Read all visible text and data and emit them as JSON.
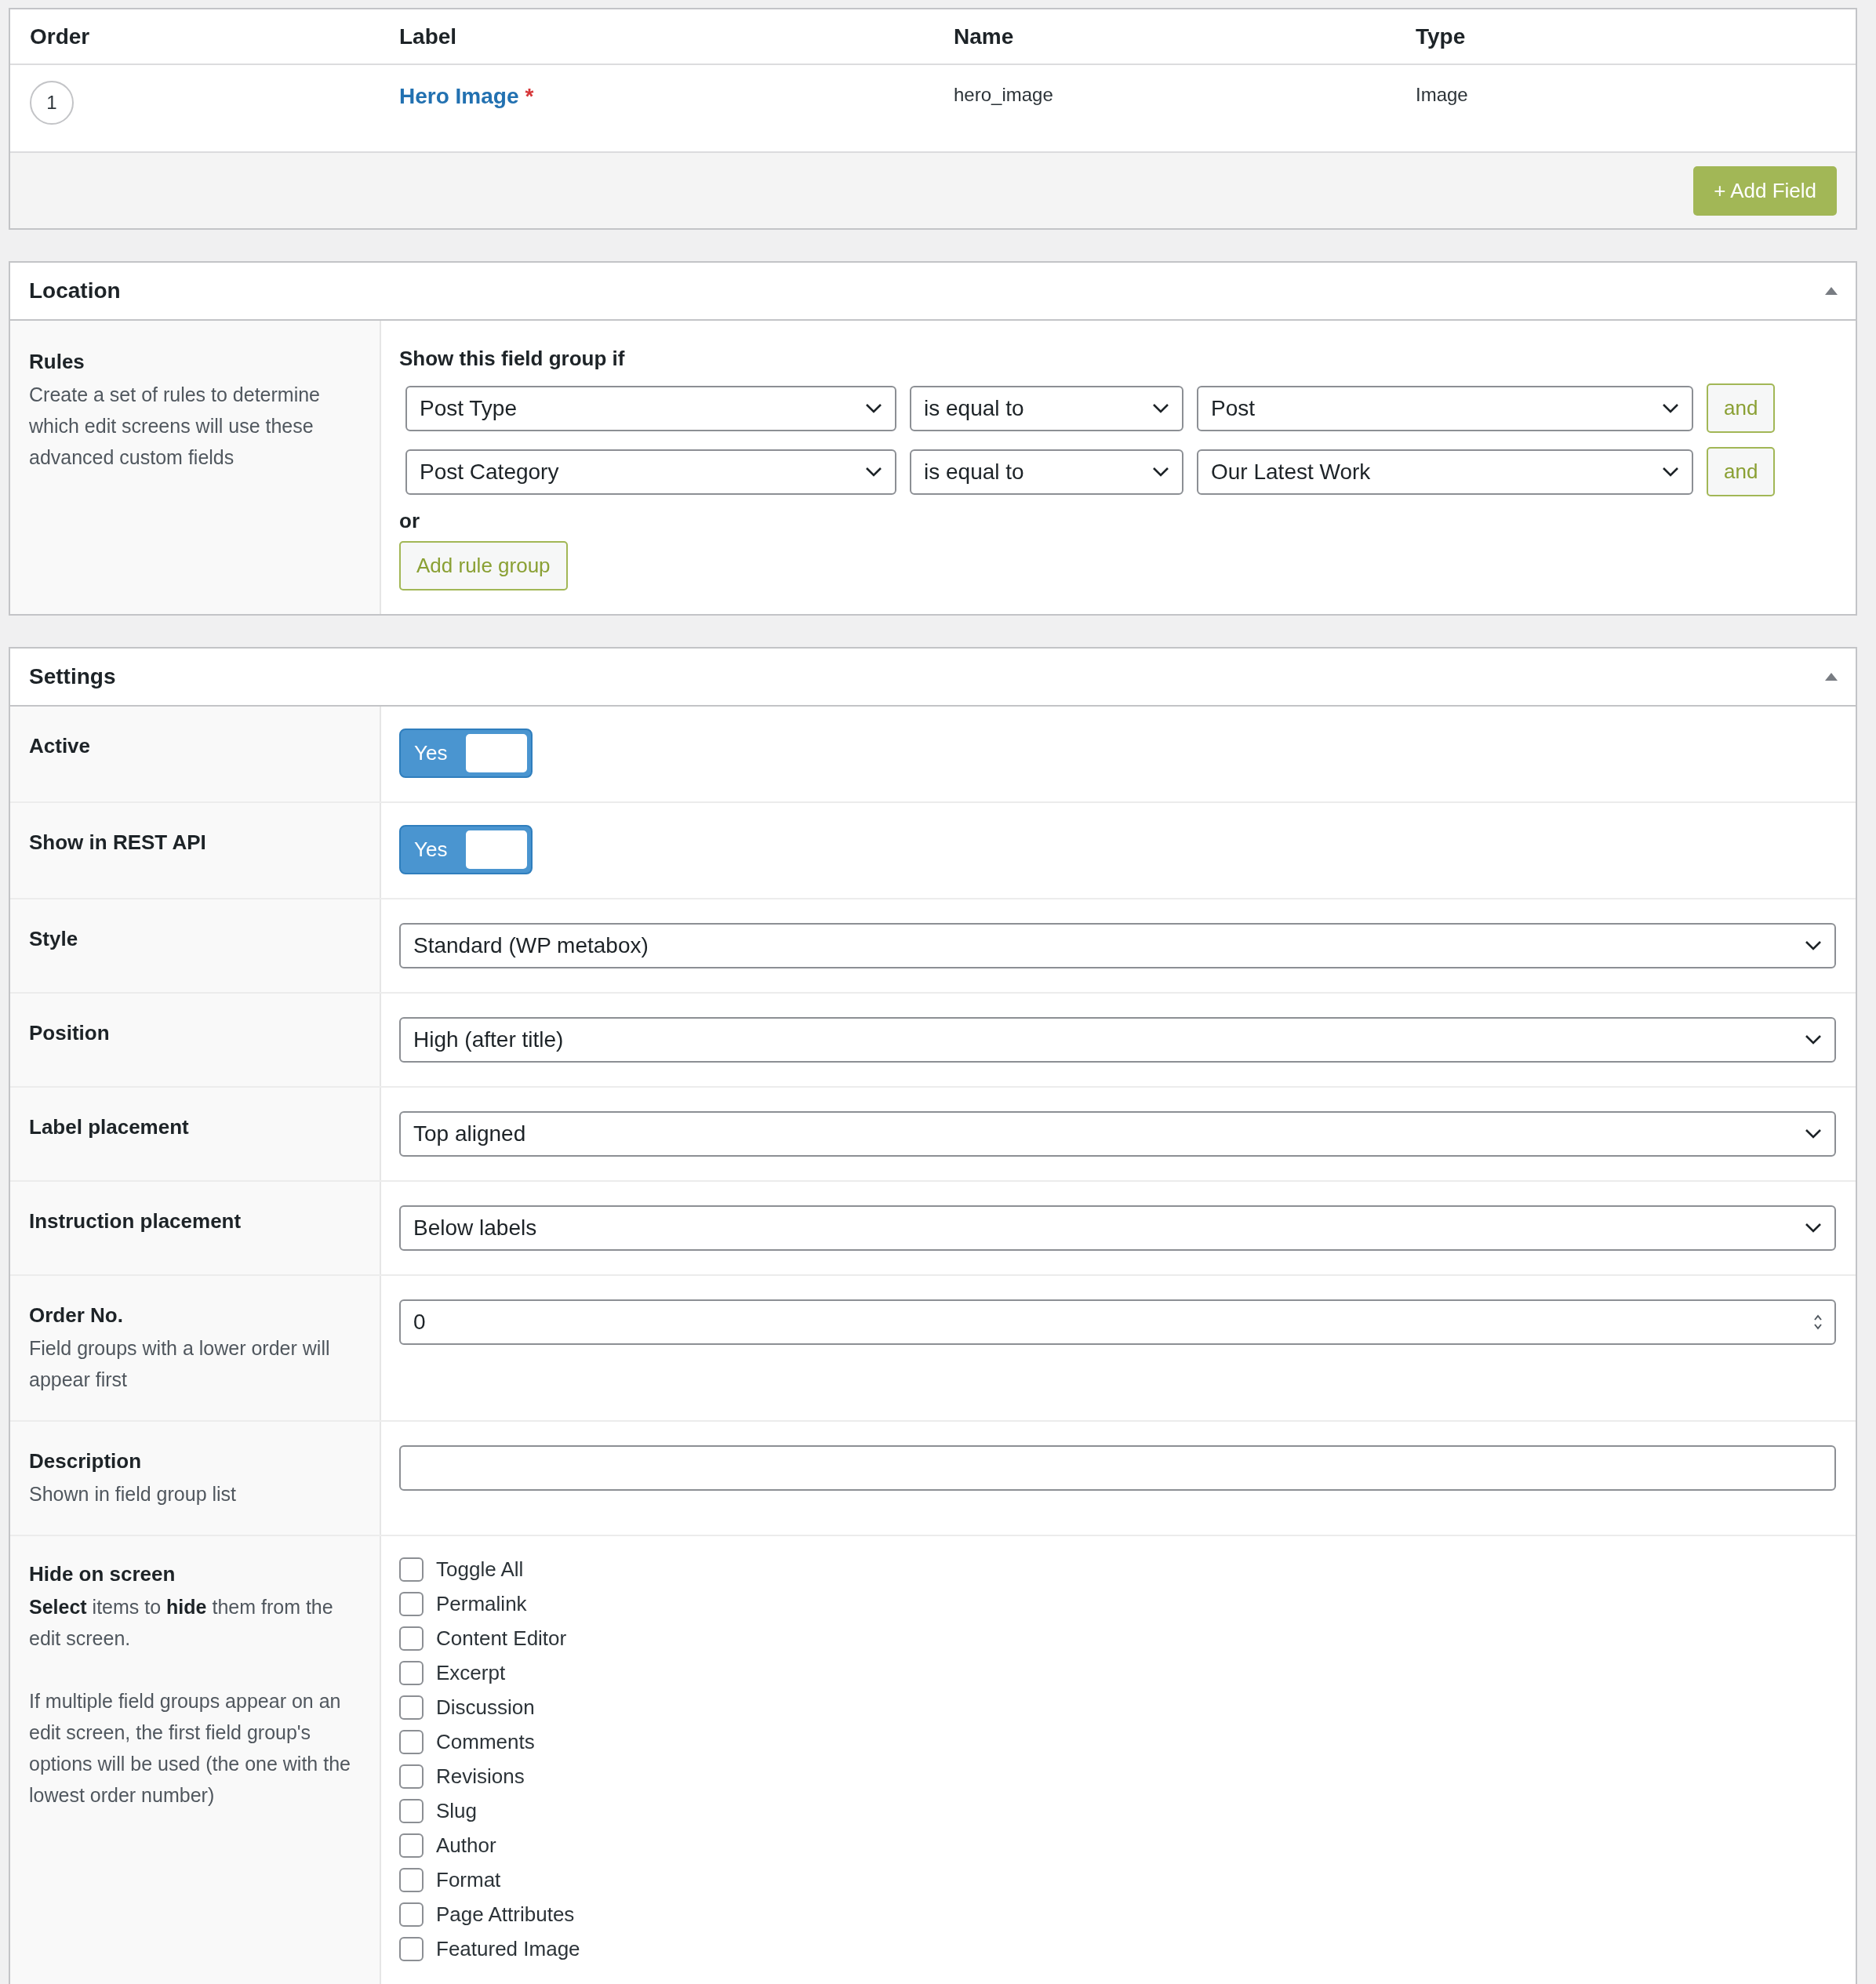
{
  "fields_table": {
    "columns": [
      "Order",
      "Label",
      "Name",
      "Type"
    ],
    "rows": [
      {
        "order": "1",
        "label": "Hero Image",
        "required_mark": "*",
        "name": "hero_image",
        "type": "Image"
      }
    ],
    "add_button": "+ Add Field"
  },
  "location": {
    "title": "Location",
    "expanded": true,
    "rules_label": "Rules",
    "rules_description": "Create a set of rules to determine which edit screens will use these advanced custom fields",
    "group_heading": "Show this field group if",
    "rules": [
      {
        "param": "Post Type",
        "operator": "is equal to",
        "value": "Post",
        "and_button": "and"
      },
      {
        "param": "Post Category",
        "operator": "is equal to",
        "value": "Our Latest Work",
        "and_button": "and"
      }
    ],
    "or_label": "or",
    "add_group_button": "Add rule group"
  },
  "settings": {
    "title": "Settings",
    "expanded": true,
    "rows": [
      {
        "kind": "toggle",
        "label": "Active",
        "on": true,
        "on_text": "Yes"
      },
      {
        "kind": "toggle",
        "label": "Show in REST API",
        "on": true,
        "on_text": "Yes"
      },
      {
        "kind": "select",
        "label": "Style",
        "value": "Standard (WP metabox)"
      },
      {
        "kind": "select",
        "label": "Position",
        "value": "High (after title)"
      },
      {
        "kind": "select",
        "label": "Label placement",
        "value": "Top aligned"
      },
      {
        "kind": "select",
        "label": "Instruction placement",
        "value": "Below labels"
      },
      {
        "kind": "number",
        "label": "Order No.",
        "description": "Field groups with a lower order will appear first",
        "value": "0"
      },
      {
        "kind": "text",
        "label": "Description",
        "description": "Shown in field group list"
      },
      {
        "kind": "checklist",
        "label": "Hide on screen",
        "description": "**Select** items to **hide** them from the edit screen.",
        "note": "If multiple field groups appear on an edit screen, the first field group's options will be used (the one with the lowest order number)",
        "items": [
          {
            "label": "Toggle All",
            "checked": false
          },
          {
            "label": "Permalink",
            "checked": false
          },
          {
            "label": "Content Editor",
            "checked": false
          },
          {
            "label": "Excerpt",
            "checked": false
          },
          {
            "label": "Discussion",
            "checked": false
          },
          {
            "label": "Comments",
            "checked": false
          },
          {
            "label": "Revisions",
            "checked": false
          },
          {
            "label": "Slug",
            "checked": false
          },
          {
            "label": "Author",
            "checked": false
          },
          {
            "label": "Format",
            "checked": false
          },
          {
            "label": "Page Attributes",
            "checked": false
          },
          {
            "label": "Featured Image",
            "checked": false
          }
        ]
      }
    ]
  }
}
